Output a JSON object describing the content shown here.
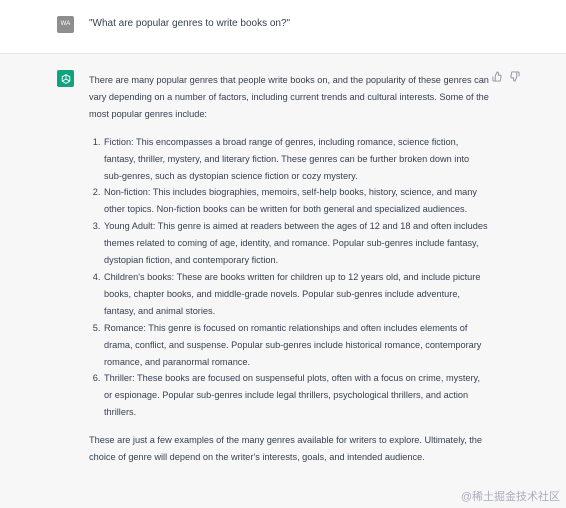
{
  "user": {
    "avatar_initials": "WA",
    "message": "\"What are popular genres to write books on?\""
  },
  "assistant": {
    "avatar_icon": "openai-logo-icon",
    "feedback": {
      "thumbs_up_icon": "thumbs-up-icon",
      "thumbs_down_icon": "thumbs-down-icon"
    },
    "intro": "There are many popular genres that people write books on, and the popularity of these genres can vary depending on a number of factors, including current trends and cultural interests. Some of the most popular genres include:",
    "list": [
      "Fiction: This encompasses a broad range of genres, including romance, science fiction, fantasy, thriller, mystery, and literary fiction. These genres can be further broken down into sub-genres, such as dystopian science fiction or cozy mystery.",
      "Non-fiction: This includes biographies, memoirs, self-help books, history, science, and many other topics. Non-fiction books can be written for both general and specialized audiences.",
      "Young Adult: This genre is aimed at readers between the ages of 12 and 18 and often includes themes related to coming of age, identity, and romance. Popular sub-genres include fantasy, dystopian fiction, and contemporary fiction.",
      "Children's books: These are books written for children up to 12 years old, and include picture books, chapter books, and middle-grade novels. Popular sub-genres include adventure, fantasy, and animal stories.",
      "Romance: This genre is focused on romantic relationships and often includes elements of drama, conflict, and suspense. Popular sub-genres include historical romance, contemporary romance, and paranormal romance.",
      "Thriller: These books are focused on suspenseful plots, often with a focus on crime, mystery, or espionage. Popular sub-genres include legal thrillers, psychological thrillers, and action thrillers."
    ],
    "outro": "These are just a few examples of the many genres available for writers to explore. Ultimately, the choice of genre will depend on the writer's interests, goals, and intended audience."
  },
  "watermark": "@稀土掘金技术社区"
}
